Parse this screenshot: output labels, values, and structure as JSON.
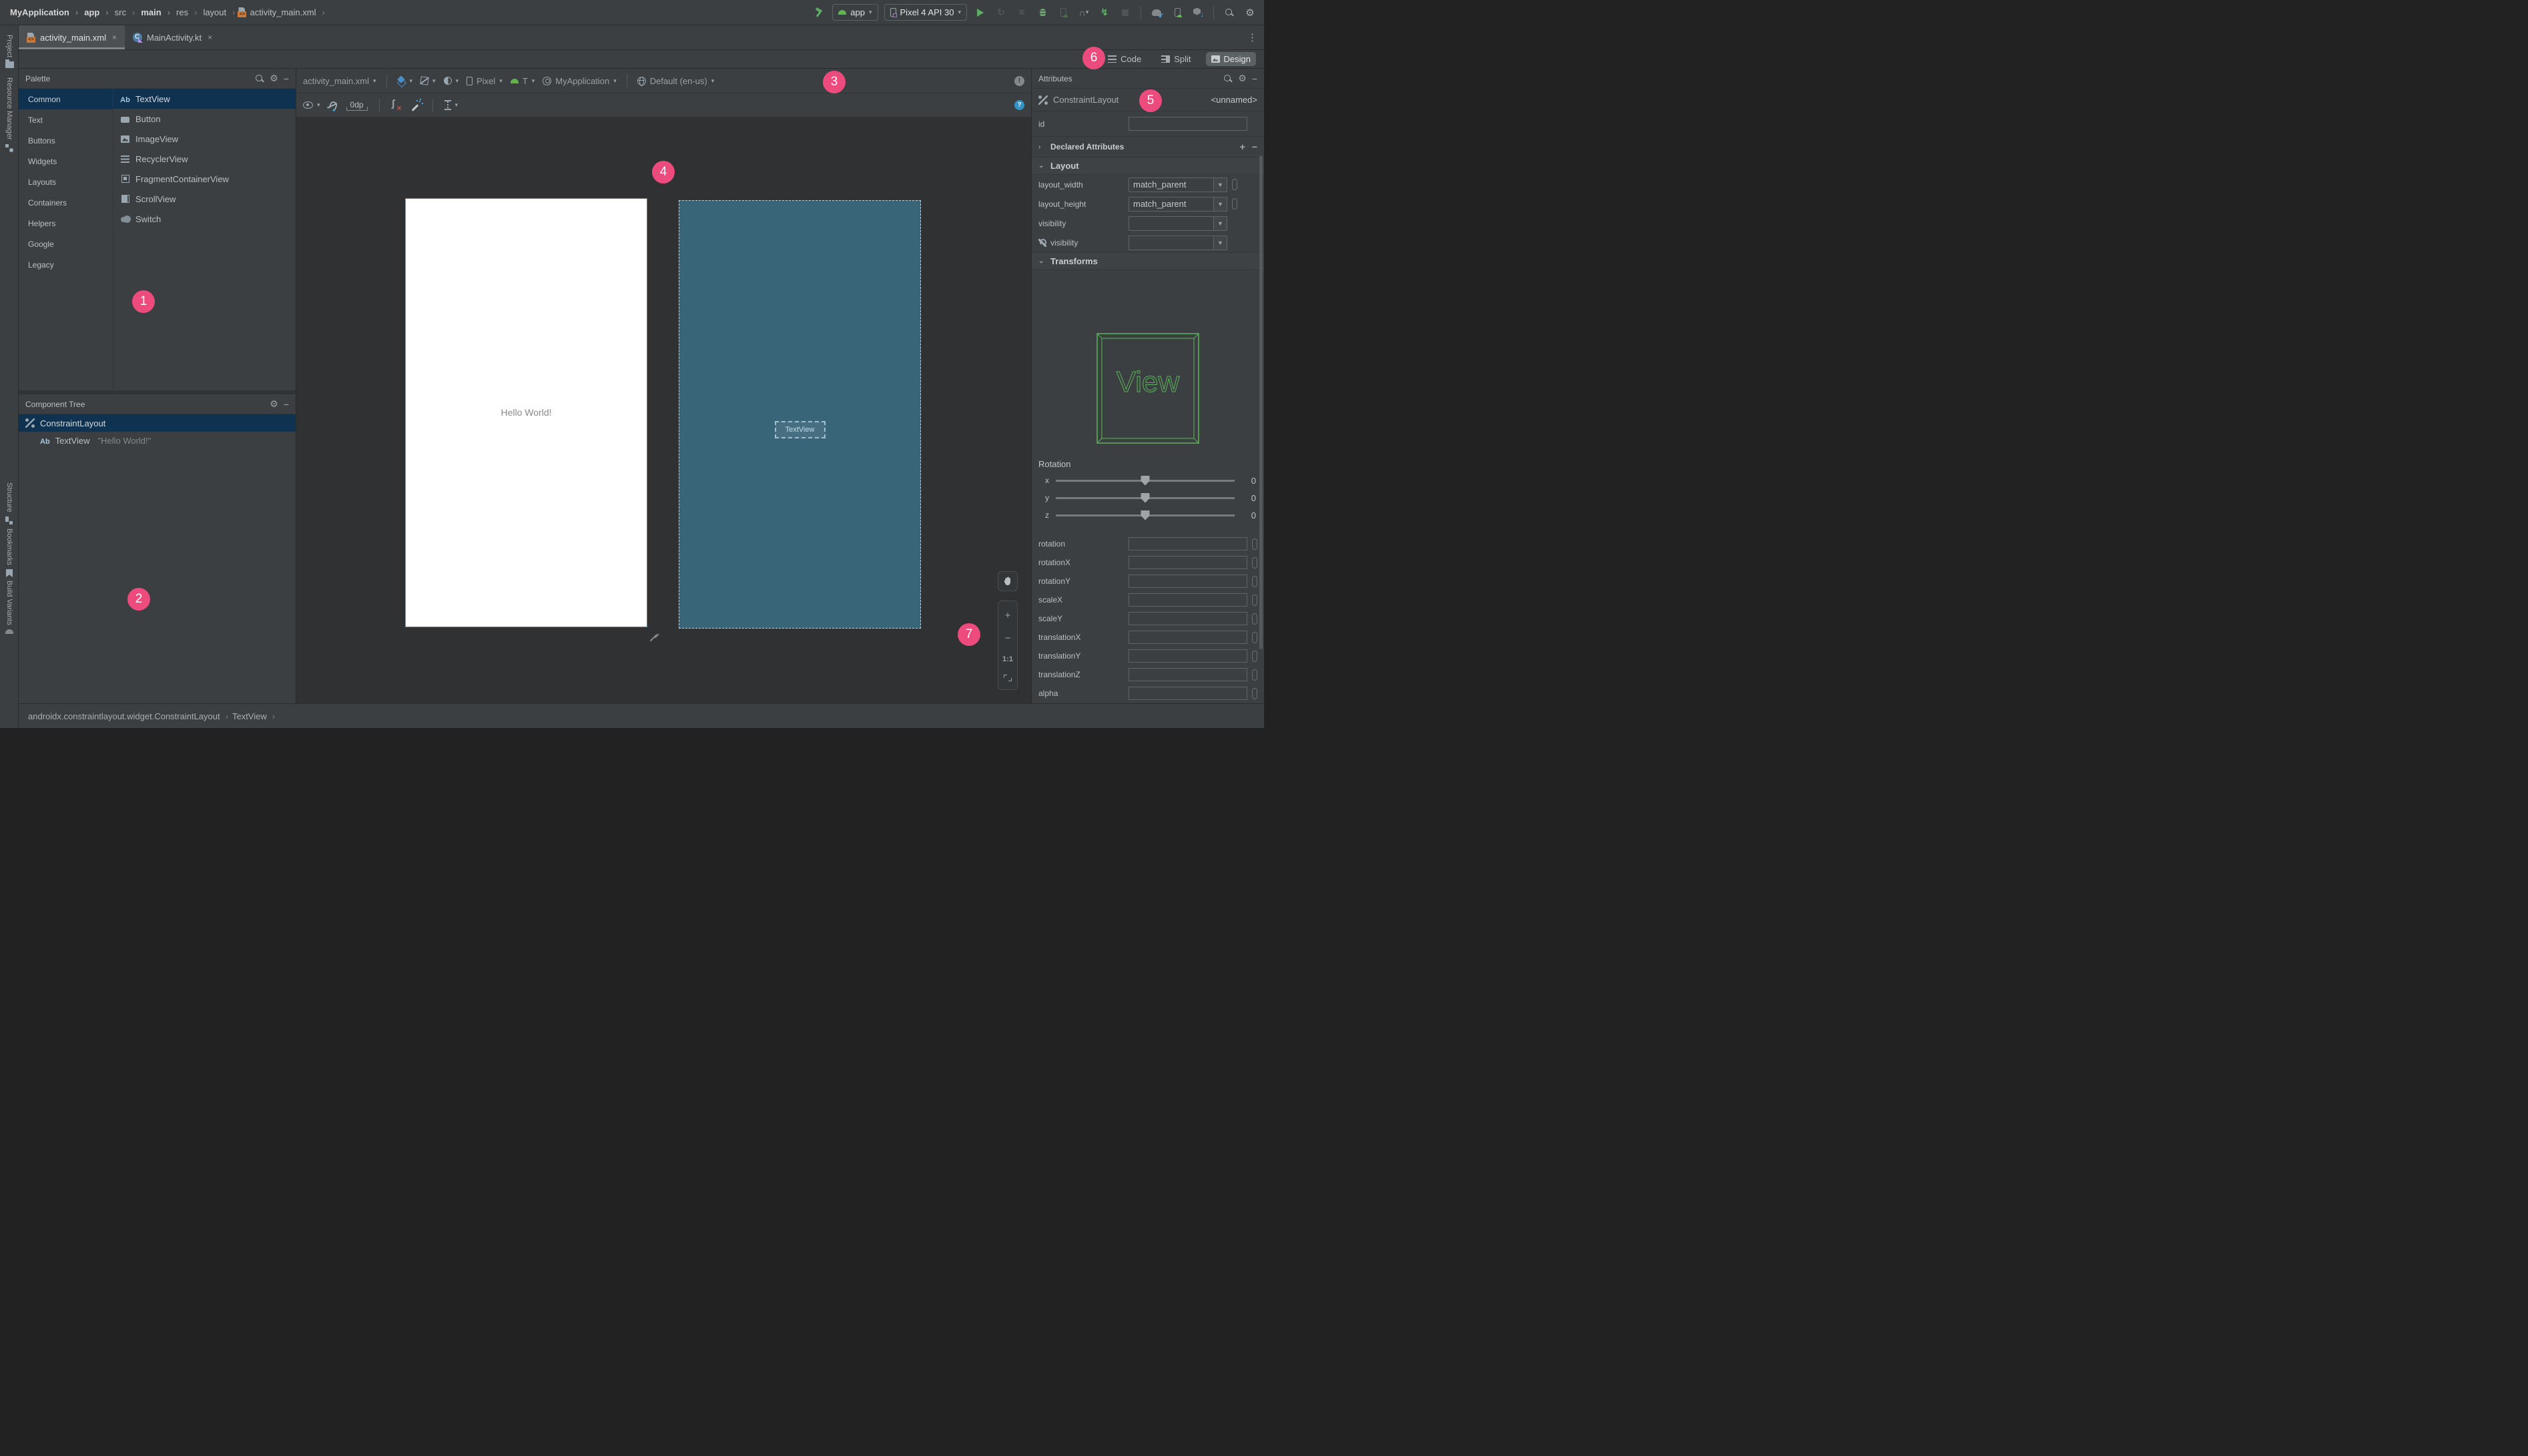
{
  "top_toolbar": {
    "breadcrumbs": [
      {
        "label": "MyApplication",
        "bold": true
      },
      {
        "label": "app",
        "bold": true
      },
      {
        "label": "src"
      },
      {
        "label": "main",
        "bold": true
      },
      {
        "label": "res"
      },
      {
        "label": "layout"
      },
      {
        "label": "activity_main.xml",
        "icon": "xmlfile"
      }
    ],
    "run_config_label": "app",
    "device_label": "Pixel 4 API 30"
  },
  "tab_bar": {
    "tabs": [
      {
        "label": "activity_main.xml",
        "icon": "xmlfile",
        "active": true
      },
      {
        "label": "MainActivity.kt",
        "icon": "kotlin"
      }
    ],
    "close_glyph": "×"
  },
  "tool_strips": {
    "top": [
      {
        "label": "Project",
        "icon": "folder"
      },
      {
        "label": "Resource Manager",
        "icon": "resmgr"
      }
    ],
    "bottom": [
      {
        "label": "Structure",
        "icon": "structure"
      },
      {
        "label": "Bookmarks",
        "icon": "bookmark"
      },
      {
        "label": "Build Variants",
        "icon": "droid"
      }
    ]
  },
  "editor_modes": [
    {
      "label": "Code",
      "icon": "code-lines"
    },
    {
      "label": "Split",
      "icon": "split"
    },
    {
      "label": "Design",
      "icon": "design",
      "active": true
    }
  ],
  "palette": {
    "title": "Palette",
    "categories": [
      {
        "label": "Common",
        "selected": true
      },
      {
        "label": "Text"
      },
      {
        "label": "Buttons"
      },
      {
        "label": "Widgets"
      },
      {
        "label": "Layouts"
      },
      {
        "label": "Containers"
      },
      {
        "label": "Helpers"
      },
      {
        "label": "Google"
      },
      {
        "label": "Legacy"
      }
    ],
    "components": [
      {
        "label": "TextView",
        "icon": "textview",
        "selected": true
      },
      {
        "label": "Button",
        "icon": "button"
      },
      {
        "label": "ImageView",
        "icon": "imageview"
      },
      {
        "label": "RecyclerView",
        "icon": "recyclerview"
      },
      {
        "label": "FragmentContainerView",
        "icon": "fragment"
      },
      {
        "label": "ScrollView",
        "icon": "scrollview"
      },
      {
        "label": "Switch",
        "icon": "switch"
      }
    ]
  },
  "design_toolbar": {
    "file": "activity_main.xml",
    "device": "Pixel",
    "api_level": "T",
    "theme": "MyApplication",
    "locale": "Default (en-us)",
    "margin": "0dp"
  },
  "canvas": {
    "hello_text": "Hello World!",
    "blueprint_textview_label": "TextView"
  },
  "zoom_controls": {
    "zoom_in": "+",
    "zoom_out": "−",
    "ratio": "1:1"
  },
  "component_tree": {
    "title": "Component Tree",
    "items": [
      {
        "label": "ConstraintLayout",
        "icon": "constraint",
        "selected": true
      },
      {
        "label": "TextView",
        "detail": "\"Hello World!\"",
        "icon": "ab",
        "indent": true
      }
    ]
  },
  "attributes": {
    "title": "Attributes",
    "component_name": "ConstraintLayout",
    "component_id": "<unnamed>",
    "id_label": "id",
    "declared_attributes_label": "Declared Attributes",
    "layout_section_label": "Layout",
    "transforms_section_label": "Transforms",
    "layout_fields": [
      {
        "label": "layout_width",
        "value": "match_parent",
        "pill": true
      },
      {
        "label": "layout_height",
        "value": "match_parent",
        "pill": true
      },
      {
        "label": "visibility",
        "value": ""
      },
      {
        "label": "visibility",
        "value": "",
        "wrench": true
      }
    ],
    "view_preview_label": "View",
    "rotation": {
      "label": "Rotation",
      "axes": [
        {
          "axis": "x",
          "value": "0"
        },
        {
          "axis": "y",
          "value": "0"
        },
        {
          "axis": "z",
          "value": "0"
        }
      ]
    },
    "transform_fields": [
      "rotation",
      "rotationX",
      "rotationY",
      "scaleX",
      "scaleY",
      "translationX",
      "translationY",
      "translationZ",
      "alpha"
    ]
  },
  "status_bar": {
    "path": [
      "androidx.constraintlayout.widget.ConstraintLayout",
      "TextView"
    ]
  },
  "badges": [
    "1",
    "2",
    "3",
    "4",
    "5",
    "6",
    "7"
  ],
  "colors": {
    "badge_pink": "#ED4B7D",
    "android_green": "#63B254",
    "blueprint_teal": "#396579",
    "selection_blue": "#0E3250",
    "accent_blue": "#4B8FC8"
  }
}
